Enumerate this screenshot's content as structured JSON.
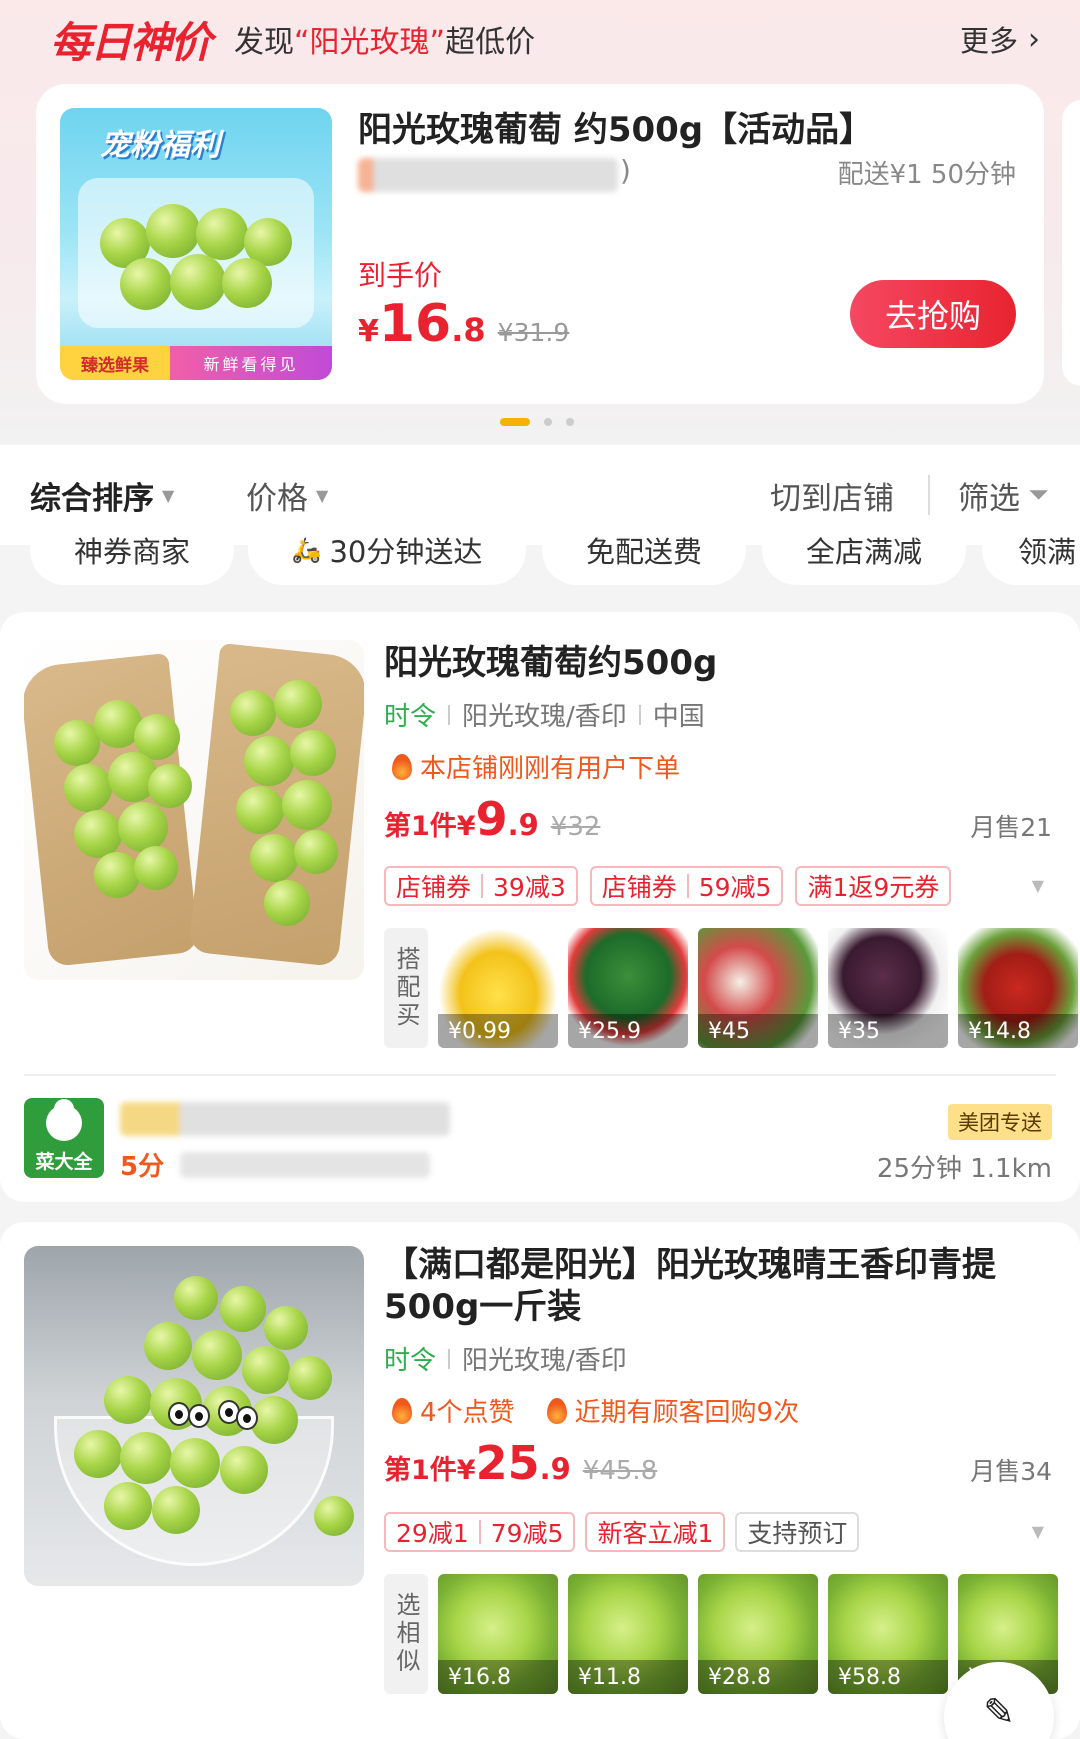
{
  "deal_banner": {
    "logo_text": "每日神价",
    "subtitle_prefix": "发现",
    "subtitle_highlight": "“阳光玫瑰”",
    "subtitle_suffix": "超低价",
    "more_label": "更多",
    "image_banner": "宠粉福利",
    "image_tag_left": "臻选鲜果",
    "image_tag_right": "新鲜看得见",
    "title": "阳光玫瑰葡萄 约500g【活动品】",
    "blurred_suffix": ")",
    "delivery": "配送¥1  50分钟",
    "price_label": "到手价",
    "price_yen": "¥",
    "price_int": "16",
    "price_dec": ".8",
    "original_price": "¥31.9",
    "grab_button": "去抢购",
    "carousel_active_index": 0,
    "carousel_count": 3
  },
  "sort_bar": {
    "items": [
      "综合排序",
      "价格",
      "切到店铺",
      "筛选"
    ]
  },
  "filter_chips": [
    "神券商家",
    "30分钟送达",
    "免配送费",
    "全店满减",
    "领满"
  ],
  "products": [
    {
      "title": "阳光玫瑰葡萄约500g",
      "season": "时令",
      "attrs": [
        "阳光玫瑰/香印",
        "中国"
      ],
      "hot": [
        "本店铺刚刚有用户下单"
      ],
      "price_prefix": "第1件¥",
      "price_int": "9",
      "price_dec": ".9",
      "original_price": "¥32",
      "monthly_sales": "月售21",
      "coupons": [
        {
          "label": "店铺券",
          "value": "39减3"
        },
        {
          "label": "店铺券",
          "value": "59减5"
        },
        {
          "label": "",
          "value": "满1返9元券"
        }
      ],
      "bundle_label": "搭配买",
      "bundle_items": [
        {
          "icon": "banana",
          "price": "¥0.99"
        },
        {
          "icon": "watermelon",
          "price": "¥25.9"
        },
        {
          "icon": "lychee",
          "price": "¥45"
        },
        {
          "icon": "mangosteen",
          "price": "¥35"
        },
        {
          "icon": "jujube",
          "price": "¥14.8"
        }
      ],
      "shop": {
        "logo_text": "菜大全",
        "rating": "5分",
        "badge": "美团专送",
        "distance": "25分钟  1.1km"
      }
    },
    {
      "title": "【满口都是阳光】阳光玫瑰晴王香印青提500g一斤装",
      "season": "时令",
      "attrs": [
        "阳光玫瑰/香印"
      ],
      "hot": [
        "4个点赞",
        "近期有顾客回购9次"
      ],
      "price_prefix": "第1件¥",
      "price_int": "25",
      "price_dec": ".9",
      "original_price": "¥45.8",
      "monthly_sales": "月售34",
      "coupons": [
        {
          "label": "",
          "value": "29减1"
        },
        {
          "label": "",
          "value": "79减5"
        },
        {
          "label": "",
          "value": "新客立减1"
        },
        {
          "label": "",
          "value": "支持预订"
        }
      ],
      "bundle_label": "选相似",
      "bundle_items": [
        {
          "icon": "grape",
          "price": "¥16.8"
        },
        {
          "icon": "grape",
          "price": "¥11.8"
        },
        {
          "icon": "grape",
          "price": "¥28.8"
        },
        {
          "icon": "grape",
          "price": "¥58.8"
        },
        {
          "icon": "grape",
          "price": "¥"
        }
      ]
    }
  ],
  "colors": {
    "brand_red": "#e8232f",
    "season_green": "#2fae4f",
    "hot_orange": "#f0591d"
  }
}
